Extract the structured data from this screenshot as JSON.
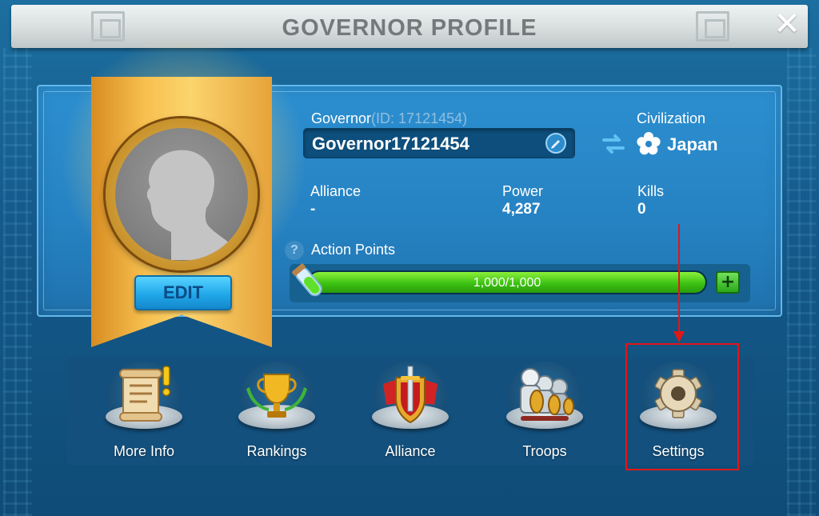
{
  "window": {
    "title": "GOVERNOR PROFILE",
    "close_label": "✕"
  },
  "portrait": {
    "edit_label": "EDIT"
  },
  "governor": {
    "label": "Governor",
    "id_text": "(ID: 17121454)",
    "name": "Governor17121454"
  },
  "civilization": {
    "label": "Civilization",
    "value": "Japan"
  },
  "stats": {
    "alliance_label": "Alliance",
    "alliance_value": "-",
    "power_label": "Power",
    "power_value": "4,287",
    "kills_label": "Kills",
    "kills_value": "0"
  },
  "action_points": {
    "label": "Action Points",
    "help_glyph": "?",
    "text": "1,000/1,000",
    "fill_fraction": 1.0,
    "plus_glyph": "+"
  },
  "menu": [
    {
      "label": "More Info",
      "icon": "scroll-icon"
    },
    {
      "label": "Rankings",
      "icon": "trophy-icon"
    },
    {
      "label": "Alliance",
      "icon": "sword-shield-icon"
    },
    {
      "label": "Troops",
      "icon": "troops-icon"
    },
    {
      "label": "Settings",
      "icon": "gear-icon"
    }
  ],
  "colors": {
    "panel_blue": "#2682c2",
    "banner_gold": "#f7c04f",
    "ap_green": "#3cc212",
    "annotation_red": "#e01818"
  }
}
